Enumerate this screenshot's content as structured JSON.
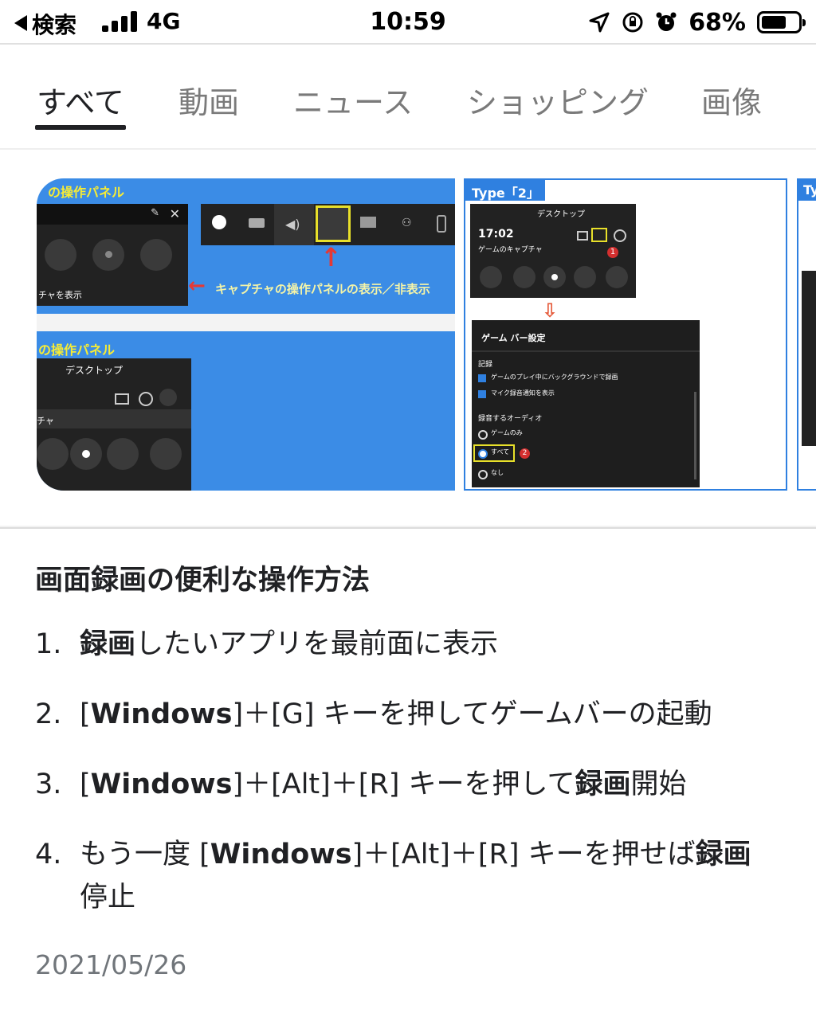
{
  "status_bar": {
    "back_label": "検索",
    "network": "4G",
    "time": "10:59",
    "battery_percent": "68%",
    "battery_level": 0.68
  },
  "tabs": [
    {
      "label": "すべて",
      "active": true
    },
    {
      "label": "動画",
      "active": false
    },
    {
      "label": "ニュース",
      "active": false
    },
    {
      "label": "ショッピング",
      "active": false
    },
    {
      "label": "画像",
      "active": false
    }
  ],
  "images": {
    "left": {
      "panel_top_label": "の操作パネル",
      "panel_bottom_label": "の操作パネル",
      "annotation": "キャプチャの操作パネルの表示／非表示",
      "desktop_label": "デスクトップ",
      "capture_show": "チャを表示",
      "capture_label": "チャ"
    },
    "middle": {
      "type_label": "Type「2」",
      "desktop_label": "デスクトップ",
      "clock": "17:02",
      "capture_label": "ゲームのキャプチャ",
      "settings_title": "ゲーム バー設定",
      "record_heading": "記録",
      "check1": "ゲームのプレイ中にバックグラウンドで録画",
      "check2": "マイク録音通知を表示",
      "audio_heading": "録音するオーディオ",
      "radio1": "ゲームのみ",
      "radio2": "すべて",
      "radio3": "なし",
      "badge1": "1",
      "badge2": "2"
    },
    "right": {
      "type_partial": "Ty"
    }
  },
  "article": {
    "title": "画面録画の便利な操作方法",
    "steps": [
      {
        "num": "1.",
        "parts": [
          {
            "t": "録画",
            "b": true
          },
          {
            "t": "したいアプリを最前面に表示",
            "b": false
          }
        ]
      },
      {
        "num": "2.",
        "parts": [
          {
            "t": "[",
            "b": false
          },
          {
            "t": "Windows",
            "b": true
          },
          {
            "t": "]＋[G] キーを押してゲームバーの起動",
            "b": false
          }
        ]
      },
      {
        "num": "3.",
        "parts": [
          {
            "t": "[",
            "b": false
          },
          {
            "t": "Windows",
            "b": true
          },
          {
            "t": "]＋[Alt]＋[R] キーを押して",
            "b": false
          },
          {
            "t": "録画",
            "b": true
          },
          {
            "t": "開始",
            "b": false
          }
        ]
      },
      {
        "num": "4.",
        "parts": [
          {
            "t": "もう一度 [",
            "b": false
          },
          {
            "t": "Windows",
            "b": true
          },
          {
            "t": "]＋[Alt]＋[R] キーを押せば",
            "b": false
          },
          {
            "t": "録画",
            "b": true
          },
          {
            "t": "停止",
            "b": false
          }
        ]
      }
    ],
    "date": "2021/05/26"
  }
}
